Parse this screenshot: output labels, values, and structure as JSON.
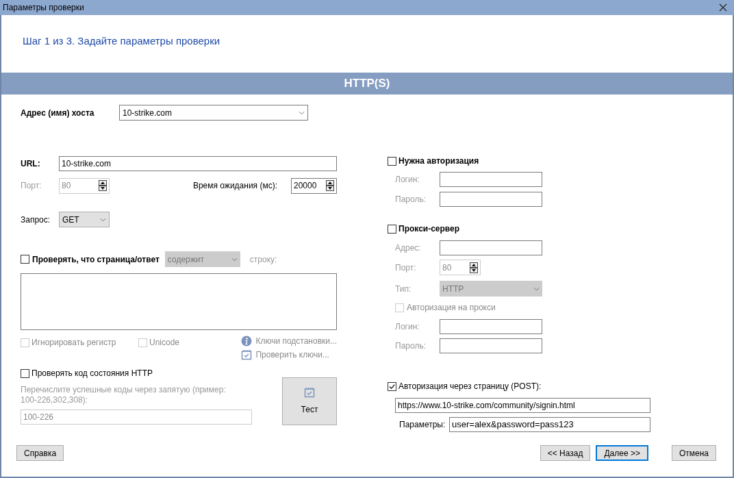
{
  "window": {
    "title": "Параметры проверки"
  },
  "step_title": "Шаг 1 из 3. Задайте параметры проверки",
  "section_header": "HTTP(S)",
  "host": {
    "label": "Адрес (имя) хоста",
    "value": "10-strike.com"
  },
  "url": {
    "label": "URL:",
    "value": "10-strike.com"
  },
  "port": {
    "label": "Порт:",
    "value": "80",
    "disabled": true
  },
  "timeout": {
    "label": "Время ожидания (мс):",
    "value": "20000",
    "disabled": false
  },
  "request": {
    "label": "Запрос:",
    "value": "GET"
  },
  "content_check": {
    "label": "Проверять, что страница/ответ",
    "checked": false,
    "condition": "содержит",
    "suffix": "строку:"
  },
  "options": [
    {
      "label": "Игнорировать регистр",
      "checked": false,
      "disabled": true
    },
    {
      "label": "Unicode",
      "checked": false,
      "disabled": true
    }
  ],
  "links": [
    {
      "kind": "info",
      "label": "Ключи подстановки..."
    },
    {
      "kind": "check",
      "label": "Проверить ключи..."
    }
  ],
  "status_check": {
    "label": "Проверять код состояния HTTP",
    "checked": false,
    "hint": "Перечислите успешные коды через запятую (пример: 100-226,302,308):",
    "value": "100-226"
  },
  "test_button": "Тест",
  "auth": {
    "label": "Нужна авторизация",
    "checked": false,
    "fields": [
      {
        "label": "Логин:"
      },
      {
        "label": "Пароль:"
      }
    ]
  },
  "proxy": {
    "label": "Прокси-сервер",
    "checked": false,
    "address_label": "Адрес:",
    "port": {
      "label": "Порт:",
      "value": "80"
    },
    "type": {
      "label": "Тип:",
      "value": "HTTP"
    },
    "proxy_auth": {
      "label": "Авторизация на прокси",
      "checked": false
    },
    "fields": [
      {
        "label": "Логин:"
      },
      {
        "label": "Пароль:"
      }
    ]
  },
  "page_auth": {
    "label": "Авторизация через страницу (POST):",
    "checked": true,
    "url": "https://www.10-strike.com/community/signin.html",
    "params_label": "Параметры:",
    "params": "user=alex&password=pass123"
  },
  "buttons": [
    {
      "label": "Справка",
      "selected": false
    },
    {
      "label": "<< Назад",
      "selected": false
    },
    {
      "label": "Далее >>",
      "selected": true
    },
    {
      "label": "Отмена",
      "selected": false
    }
  ]
}
